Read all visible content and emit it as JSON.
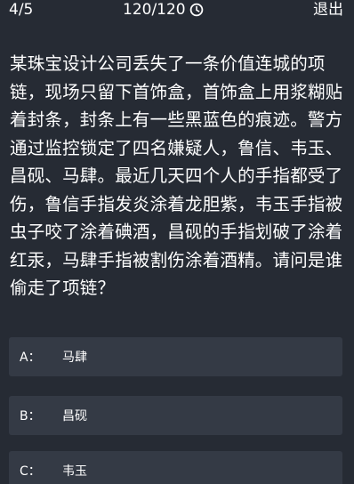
{
  "header": {
    "progress": "4/5",
    "timer": "120/120",
    "exit_label": "退出"
  },
  "question": {
    "text": "某珠宝设计公司丢失了一条价值连城的项链，现场只留下首饰盒，首饰盒上用浆糊贴着封条，封条上有一些黑蓝色的痕迹。警方通过监控锁定了四名嫌疑人，鲁信、韦玉、昌砚、马肆。最近几天四个人的手指都受了伤，鲁信手指发炎涂着龙胆紫，韦玉手指被虫子咬了涂着碘酒，昌砚的手指划破了涂着红汞，马肆手指被割伤涂着酒精。请问是谁偷走了项链？"
  },
  "options": [
    {
      "letter": "A：",
      "text": "马肆"
    },
    {
      "letter": "B：",
      "text": "昌砚"
    },
    {
      "letter": "C：",
      "text": "韦玉"
    }
  ],
  "colors": {
    "background": "#262b34",
    "option_background": "#343a45",
    "text": "#ffffff"
  },
  "icons": {
    "timer": "clock-icon"
  }
}
